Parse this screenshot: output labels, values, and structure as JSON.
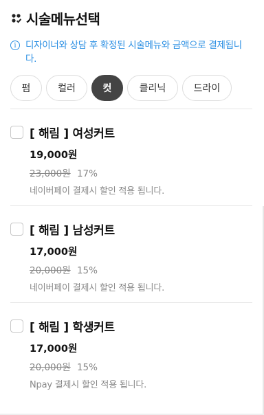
{
  "header": {
    "title": "시술메뉴선택",
    "icon": "menu-grid-icon"
  },
  "notice": {
    "icon": "info-icon",
    "text": "디자이너와 상담 후 확정된 시술메뉴와 금액으로 결제됩니다.",
    "color": "#2b8fe3"
  },
  "categories": [
    {
      "label": "펌",
      "active": false
    },
    {
      "label": "컬러",
      "active": false
    },
    {
      "label": "컷",
      "active": true
    },
    {
      "label": "클리닉",
      "active": false
    },
    {
      "label": "드라이",
      "active": false
    }
  ],
  "items": [
    {
      "name": "[ 해림 ] 여성커트",
      "price": "19,000원",
      "original_price": "23,000원",
      "discount": "17%",
      "note": "네이버페이 결제시 할인 적용 됩니다.",
      "checked": false
    },
    {
      "name": "[ 해림 ] 남성커트",
      "price": "17,000원",
      "original_price": "20,000원",
      "discount": "15%",
      "note": "네이버페이 결제시 할인 적용 됩니다.",
      "checked": false
    },
    {
      "name": "[ 해림 ] 학생커트",
      "price": "17,000원",
      "original_price": "20,000원",
      "discount": "15%",
      "note": "Npay 결제시 할인 적용 됩니다.",
      "checked": false
    }
  ]
}
